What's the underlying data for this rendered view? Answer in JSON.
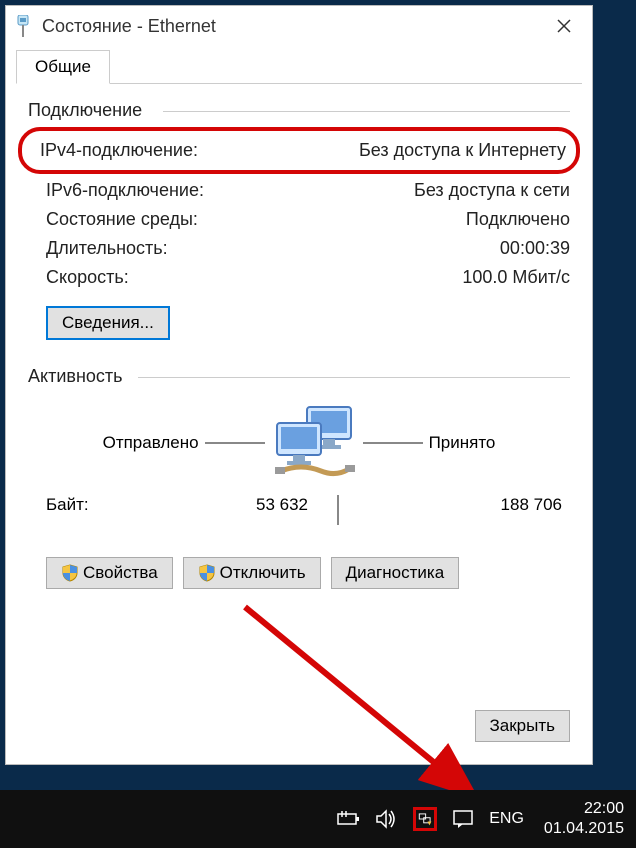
{
  "window": {
    "title": "Состояние - Ethernet",
    "tab_general": "Общие",
    "group_connection": "Подключение",
    "group_activity": "Активность",
    "rows": {
      "ipv4_label": "IPv4-подключение:",
      "ipv4_value": "Без доступа к Интернету",
      "ipv6_label": "IPv6-подключение:",
      "ipv6_value": "Без доступа к сети",
      "media_label": "Состояние среды:",
      "media_value": "Подключено",
      "duration_label": "Длительность:",
      "duration_value": "00:00:39",
      "speed_label": "Скорость:",
      "speed_value": "100.0 Мбит/с"
    },
    "buttons": {
      "details": "Сведения...",
      "properties": "Свойства",
      "disable": "Отключить",
      "diagnose": "Диагностика",
      "close": "Закрыть"
    },
    "activity": {
      "sent_label": "Отправлено",
      "recv_label": "Принято",
      "bytes_label": "Байт:",
      "bytes_sent": "53 632",
      "bytes_recv": "188 706"
    }
  },
  "taskbar": {
    "lang": "ENG",
    "time": "22:00",
    "date": "01.04.2015"
  }
}
